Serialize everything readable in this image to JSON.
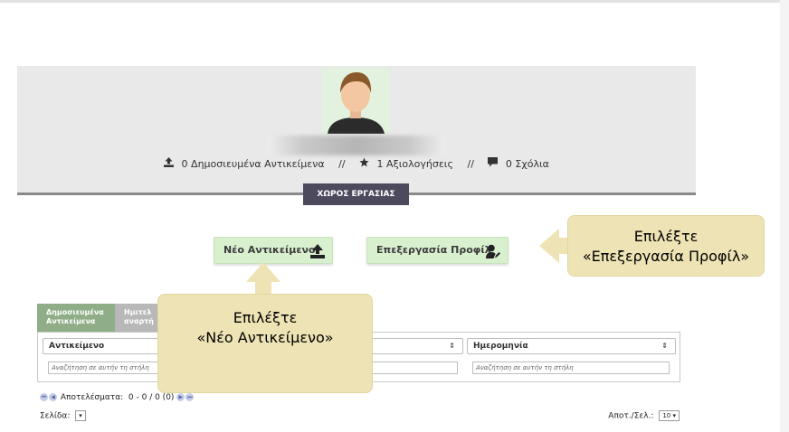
{
  "profile": {
    "published_count": "0",
    "published_label": "Δημοσιευμένα Αντικείμενα",
    "separator": "//",
    "ratings_count": "1",
    "ratings_label": "Αξιολογήσεις",
    "comments_count": "0",
    "comments_label": "Σχόλια",
    "workspace_tab": "ΧΩΡΟΣ ΕΡΓΑΣΙΑΣ"
  },
  "actions": {
    "new_item": "Νέο Αντικείμενο",
    "edit_profile": "Επεξεργασία Προφίλ"
  },
  "callouts": {
    "edit_line1": "Επιλέξτε",
    "edit_line2": "«Επεξεργασία Προφίλ»",
    "new_line1": "Επιλέξτε",
    "new_line2": "«Νέο Αντικείμενο»"
  },
  "tabs": [
    {
      "label_line1": "Δημοσιευμένα",
      "label_line2": "Αντικείμενα",
      "active": true
    },
    {
      "label_line1": "Ημιτελ",
      "label_line2": "αναρτή",
      "active": false
    }
  ],
  "grid": {
    "columns": [
      {
        "label": "Αντικείμενο",
        "filter_placeholder": "Αναζήτηση σε αυτήν τη στήλη"
      },
      {
        "label": "",
        "filter_placeholder": ""
      },
      {
        "label": "Ημερομηνία",
        "filter_placeholder": "Αναζήτηση σε αυτήν τη στήλη"
      }
    ],
    "sort_icon": "⇕"
  },
  "pager": {
    "results_label": "Αποτελέσματα:",
    "results_value": "0 - 0 / 0 (0)",
    "page_label": "Σελίδα:",
    "page_value": "▾",
    "per_page_label": "Αποτ./Σελ.:",
    "per_page_value": "10 ▾"
  },
  "colors": {
    "workspace_tab": "#4d4a5e",
    "action_button": "#d9f0cf",
    "callout": "#ede3b4",
    "active_tab": "#8fae87"
  }
}
